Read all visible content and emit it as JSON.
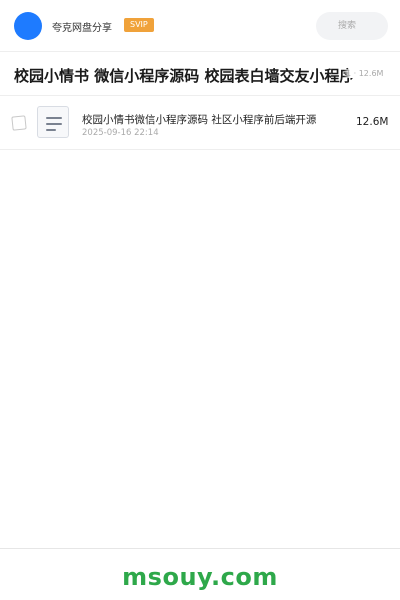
{
  "header": {
    "user_name": "夸克网盘分享",
    "badge": "SVIP",
    "search_placeholder": "搜索",
    "colors": {
      "avatar": "#1e7bff",
      "badge": "#f0a23a"
    }
  },
  "share": {
    "title": "校园小情书 微信小程序源码 校园表白墙交友小程序",
    "meta": "1 · 12.6M"
  },
  "files": [
    {
      "icon": "document-icon",
      "name": "校园小情书微信小程序源码  社区小程序前后端开源",
      "modified": "2025-09-16 22:14",
      "size": "12.6M"
    }
  ],
  "footer": {
    "brand": "msouy.com",
    "color": "#2ea84a"
  }
}
